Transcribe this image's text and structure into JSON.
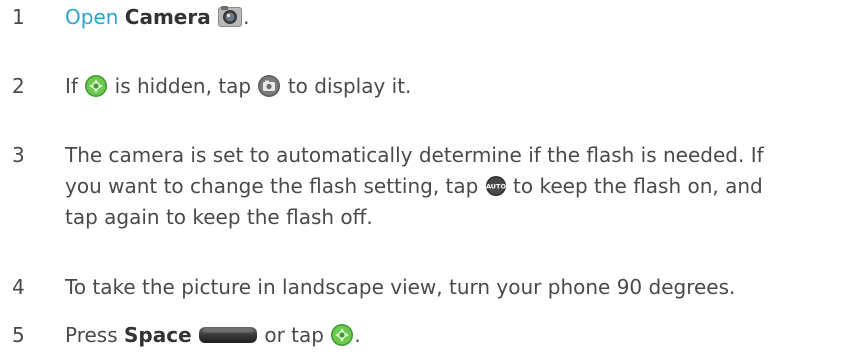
{
  "steps": [
    {
      "number": "1",
      "link": "Open",
      "app_name": "Camera",
      "end": ".",
      "icon": "camera-app-icon"
    },
    {
      "number": "2",
      "pre": "If",
      "mid": "is hidden, tap",
      "post": "to display it.",
      "icons": [
        "shutter-icon",
        "camera-mode-icon"
      ]
    },
    {
      "number": "3",
      "line1": "The camera is set to automatically determine if the flash is needed. If",
      "line2_pre": "you want to change the flash setting, tap",
      "line2_post": "to keep the flash on, and",
      "line3": "tap again to keep the flash off.",
      "icon": "flash-auto-icon",
      "icon_text": "AUTO"
    },
    {
      "number": "4",
      "text": "To take the picture in landscape view, turn your phone 90 degrees."
    },
    {
      "number": "5",
      "pre": "Press",
      "key": "Space",
      "mid": "or tap",
      "end": ".",
      "icons": [
        "space-key-icon",
        "shutter-icon"
      ]
    }
  ],
  "colors": {
    "text": "#4a4a4a",
    "link": "#2aa6c8",
    "shutter_green": "#5cc14a"
  }
}
